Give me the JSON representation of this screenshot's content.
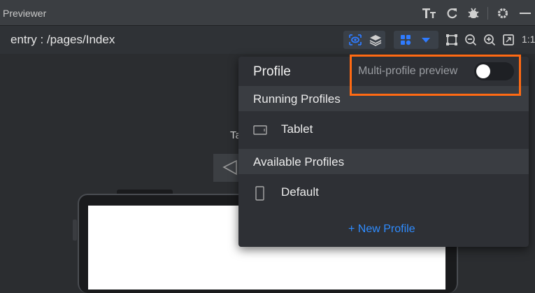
{
  "window": {
    "title": "Previewer"
  },
  "toolbar": {
    "path": "entry : /pages/Index",
    "ratio_label": "1:1"
  },
  "canvas": {
    "device_label": "Ta"
  },
  "profile_popup": {
    "title": "Profile",
    "multi_profile_label": "Multi-profile preview",
    "multi_profile_enabled": false,
    "running_section": "Running Profiles",
    "running_profiles": [
      {
        "name": "Tablet",
        "icon": "tablet-icon"
      }
    ],
    "available_section": "Available Profiles",
    "available_profiles": [
      {
        "name": "Default",
        "icon": "phone-icon"
      }
    ],
    "new_profile_label": "+ New Profile"
  },
  "colors": {
    "highlight": "#ff6a13",
    "link": "#2f8cff",
    "accent_blue": "#2f7bff"
  }
}
